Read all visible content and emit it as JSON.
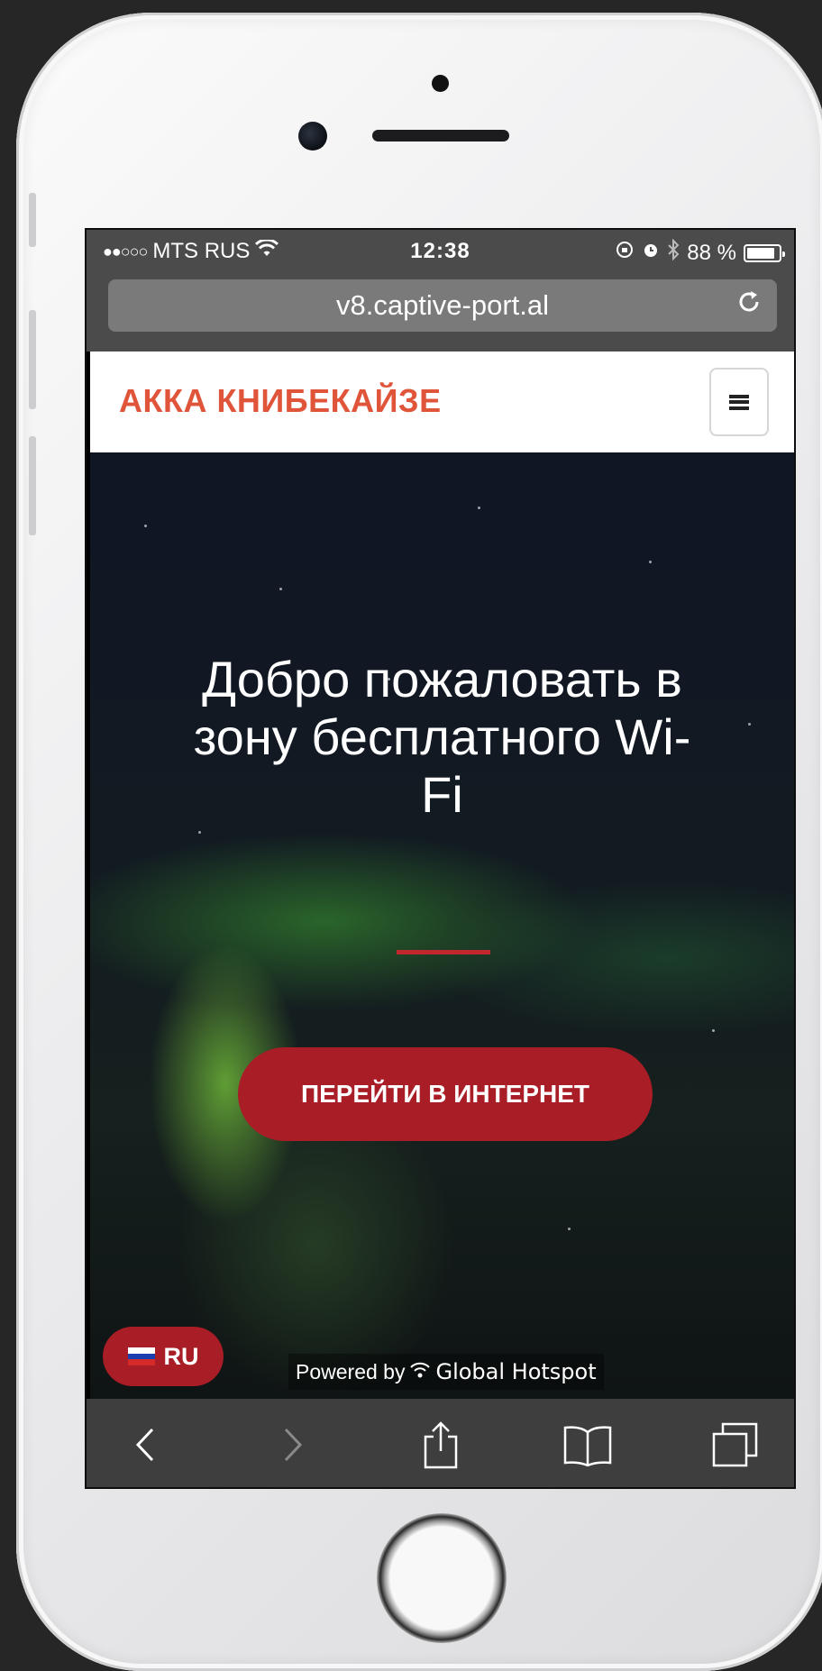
{
  "status_bar": {
    "carrier": "MTS RUS",
    "signal_dots": "●●○○○",
    "time": "12:38",
    "battery_percent": "88 %",
    "battery_level": 0.88
  },
  "browser": {
    "url": "v8.captive-port.al"
  },
  "site": {
    "brand": "АККА КНИБЕКАЙЗЕ",
    "hero_title": "Добро пожаловать в зону бесплатного Wi-Fi",
    "cta_label": "ПЕРЕЙТИ В ИНТЕРНЕТ",
    "language_label": "RU",
    "powered_by": "Powered by",
    "powered_brand": "Global Hotspot"
  },
  "colors": {
    "brand": "#e0553a",
    "accent": "#a81d26"
  },
  "icons": {
    "wifi": "wifi-icon",
    "reload": "reload-icon",
    "menu": "hamburger-menu-icon",
    "back": "back-icon",
    "forward": "forward-icon",
    "share": "share-icon",
    "bookmarks": "bookmarks-icon",
    "tabs": "tabs-icon"
  }
}
